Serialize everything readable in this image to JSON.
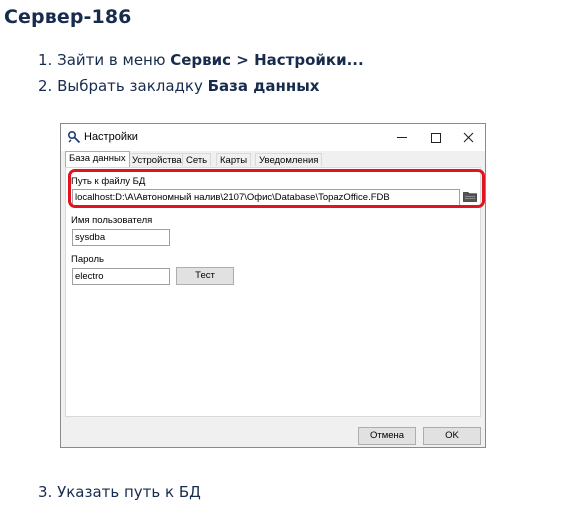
{
  "doc": {
    "title": "Сервер-186",
    "step1_prefix": "1. Зайти в меню ",
    "step1_bold": "Сервис > Настройки...",
    "step2_prefix": "2. Выбрать закладку ",
    "step2_bold": "База данных",
    "step3": "3. Указать путь к БД"
  },
  "window": {
    "title": "Настройки",
    "tabs": [
      "База данных",
      "Устройства",
      "Сеть",
      "Карты",
      "Уведомления"
    ],
    "active_tab": "База данных",
    "db_path_label": "Путь к файлу БД",
    "db_path_value": "localhost:D:\\A\\Автономный налив\\2107\\Офис\\Database\\TopazOffice.FDB",
    "user_label": "Имя пользователя",
    "user_value": "sysdba",
    "password_label": "Пароль",
    "password_value": "electro",
    "test_button": "Тест",
    "cancel_button": "Отмена",
    "ok_button": "OK"
  },
  "colors": {
    "doc_text": "#172b4d",
    "highlight": "#e0141e",
    "dialog_bg": "#f0f0f0"
  }
}
